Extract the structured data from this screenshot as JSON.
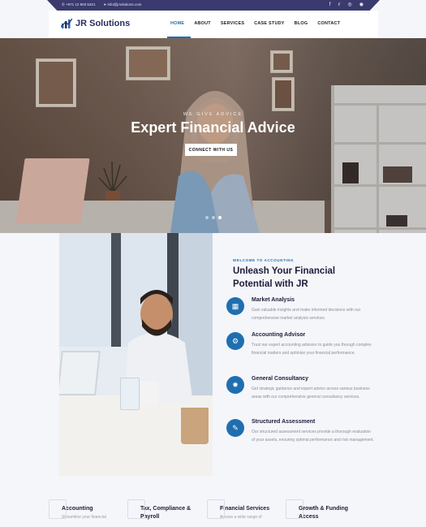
{
  "topbar": {
    "phone": "+971 12 903 5321",
    "email": "info@jrsolutions.com",
    "socials": [
      "facebook-icon",
      "twitter-icon",
      "instagram-icon",
      "dribbble-icon"
    ]
  },
  "header": {
    "logo": "JR Solutions",
    "nav": [
      "HOME",
      "ABOUT",
      "SERVICES",
      "CASE STUDY",
      "BLOG",
      "CONTACT"
    ],
    "active": "HOME"
  },
  "hero": {
    "kicker": "WE GIVE ADVICE",
    "title": "Expert Financial Advice",
    "button": "CONNECT WITH US",
    "slides": 3,
    "active_slide": 3
  },
  "about": {
    "kicker": "WELCOME TO ACCOUNTING",
    "title_line1": "Unleash Your Financial",
    "title_line2": "Potential with JR",
    "features": [
      {
        "icon": "chart-icon",
        "title": "Market Analysis",
        "desc": "Gain valuable insights and make informed decisions with our comprehensive market analysis services."
      },
      {
        "icon": "advisor-icon",
        "title": "Accounting Advisor",
        "desc": "Trust our expert accounting advisors to guide you through complex financial matters and optimize your financial performance."
      },
      {
        "icon": "consultancy-icon",
        "title": "General Consultancy",
        "desc": "Get strategic guidance and expert advice across various business areas with our comprehensive general consultancy services."
      },
      {
        "icon": "assessment-icon",
        "title": "Structured Assessment",
        "desc": "Our structured assessment services provide a thorough evaluation of your assets, ensuring optimal performance and risk management."
      }
    ]
  },
  "services": [
    {
      "title": "Accounting",
      "desc": "Streamline your financial"
    },
    {
      "title": "Tax, Compliance & Payroll",
      "desc": ""
    },
    {
      "title": "Financial Services",
      "desc": "Access a wide range of"
    },
    {
      "title": "Growth & Funding Access",
      "desc": ""
    }
  ],
  "colors": {
    "navy": "#3b3a6e",
    "accent": "#1f6fb0",
    "heading": "#1d1d3a"
  }
}
